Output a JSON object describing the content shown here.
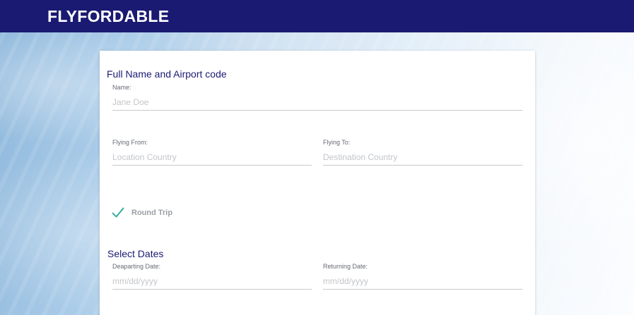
{
  "app": {
    "brand": "FLYFORDABLE"
  },
  "form": {
    "section_name": "Full Name and Airport code",
    "name": {
      "label": "Name:",
      "placeholder": "Jane Doe",
      "value": ""
    },
    "flying_from": {
      "label": "Flying From:",
      "placeholder": "Location Country",
      "value": ""
    },
    "flying_to": {
      "label": "Flying To:",
      "placeholder": "Destination Country",
      "value": ""
    },
    "round_trip": {
      "label": "Round Trip",
      "checked": true,
      "icon": "check-icon",
      "color": "#2aa79b"
    },
    "section_dates": "Select Dates",
    "departing": {
      "label": "Deaparting Date:",
      "placeholder": "mm/dd/yyyy",
      "value": ""
    },
    "returning": {
      "label": "Returning Date:",
      "placeholder": "mm/dd/yyyy",
      "value": ""
    }
  },
  "colors": {
    "header_bg": "#1a1a72",
    "title": "#1a1a72",
    "accent": "#2aa79b"
  }
}
